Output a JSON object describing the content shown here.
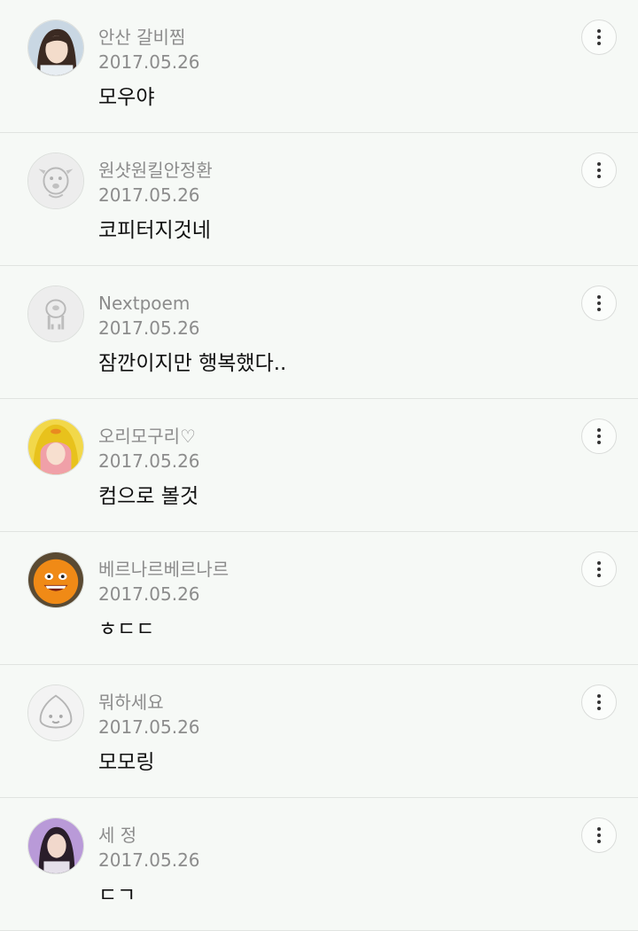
{
  "comments": [
    {
      "username": "안산 갈비찜",
      "date": "2017.05.26",
      "text": "모우야",
      "avatar_icon": "profile-photo-woman"
    },
    {
      "username": "원샷원킬안정환",
      "date": "2017.05.26",
      "text": "코피터지것네",
      "avatar_icon": "default-dog-character"
    },
    {
      "username": "Nextpoem",
      "date": "2017.05.26",
      "text": "잠깐이지만 행복했다..",
      "avatar_icon": "default-alien-character"
    },
    {
      "username": "오리모구리♡",
      "date": "2017.05.26",
      "text": "컴으로 볼것",
      "avatar_icon": "profile-photo-duck-hood"
    },
    {
      "username": "베르나르베르나르",
      "date": "2017.05.26",
      "text": "ㅎㄷㄷ",
      "avatar_icon": "annoying-orange"
    },
    {
      "username": "뭐하세요",
      "date": "2017.05.26",
      "text": "모모링",
      "avatar_icon": "default-peach-character"
    },
    {
      "username": "세 정",
      "date": "2017.05.26",
      "text": "ㄷㄱ",
      "avatar_icon": "profile-photo-woman"
    }
  ],
  "colors": {
    "background": "#f6f9f6",
    "meta_text": "#8c8c8c",
    "comment_text": "#111111",
    "divider": "#e1e4e1"
  }
}
